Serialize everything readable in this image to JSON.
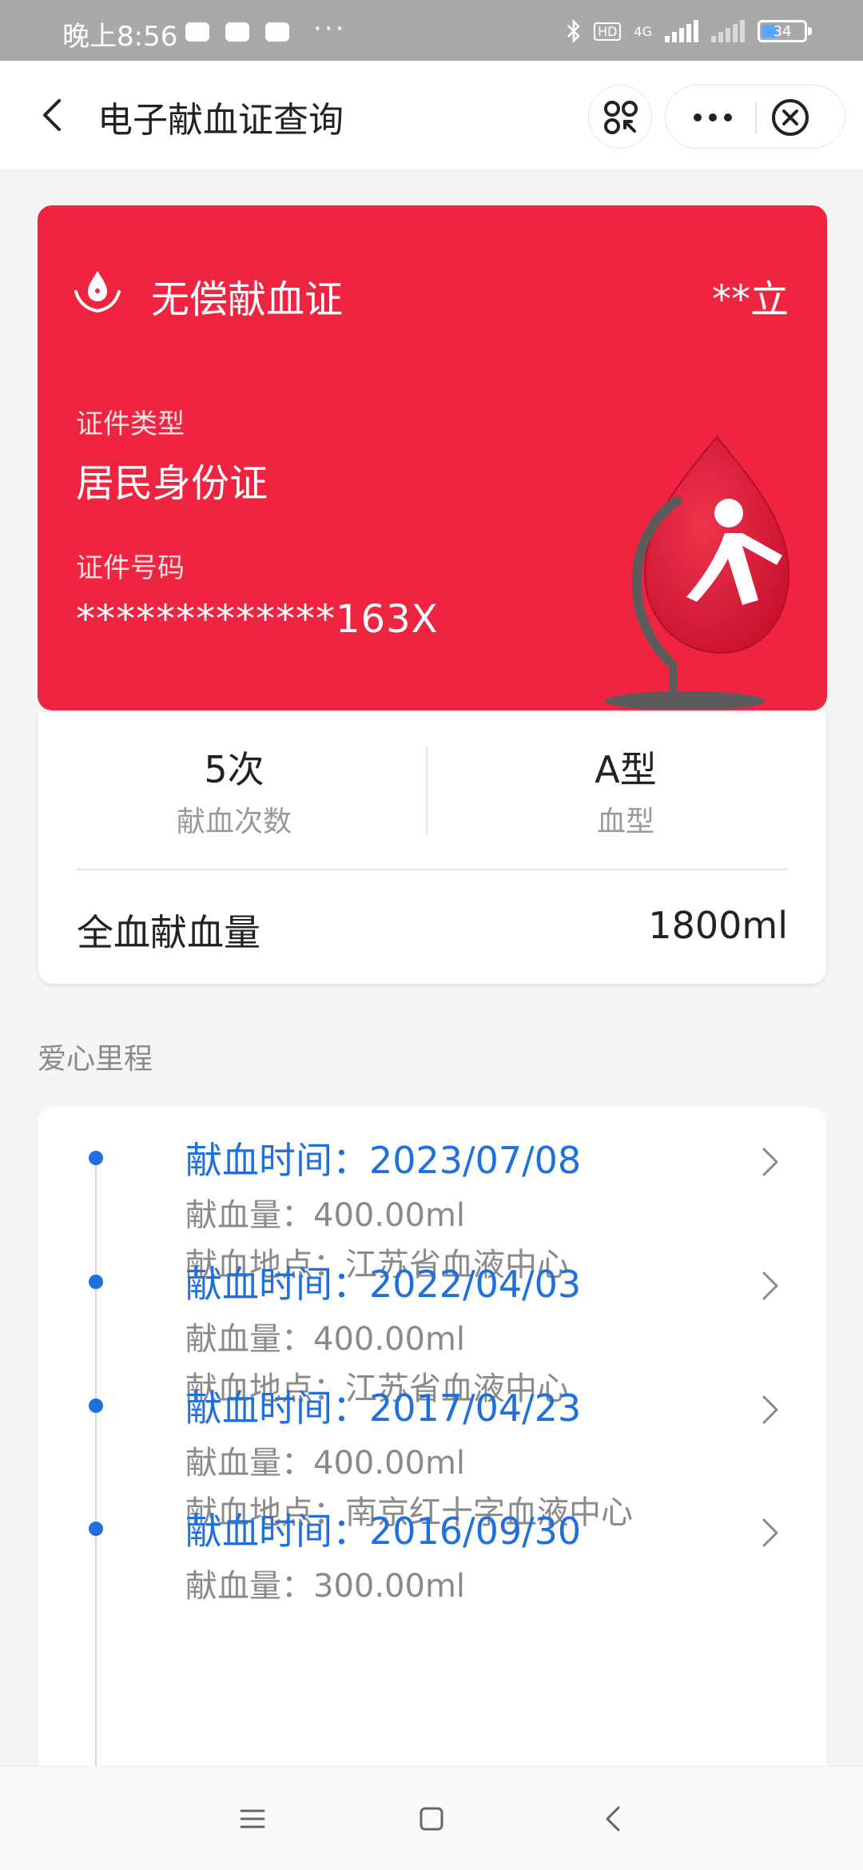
{
  "status_bar": {
    "time": "晚上8:56",
    "battery_percent": "34",
    "network": "4G",
    "hd": "HD",
    "icons": [
      "message-icon",
      "chat-icon",
      "app-icon",
      "more-notifications-icon",
      "bluetooth-icon",
      "signal-icon",
      "battery-icon"
    ]
  },
  "nav": {
    "title": "电子献血证查询",
    "icons": [
      "back-icon",
      "scan-icon",
      "more-icon",
      "close-icon"
    ]
  },
  "card": {
    "title": "无偿献血证",
    "holder_name": "**立",
    "id_type_label": "证件类型",
    "id_type_value": "居民身份证",
    "id_number_label": "证件号码",
    "id_number_value": "*************163X",
    "bg_color": "#ee2440"
  },
  "stats": {
    "donation_count_value": "5次",
    "donation_count_label": "献血次数",
    "blood_type_value": "A型",
    "blood_type_label": "血型",
    "whole_blood_label": "全血献血量",
    "whole_blood_value": "1800ml"
  },
  "section_title": "爱心里程",
  "records": [
    {
      "date": "献血时间：2023/07/08",
      "volume": "献血量：400.00ml",
      "place": "献血地点：江苏省血液中心"
    },
    {
      "date": "献血时间：2022/04/03",
      "volume": "献血量：400.00ml",
      "place": "献血地点：江苏省血液中心"
    },
    {
      "date": "献血时间：2017/04/23",
      "volume": "献血量：400.00ml",
      "place": "献血地点：南京红十字血液中心"
    },
    {
      "date": "献血时间：2016/09/30",
      "volume": "献血量：300.00ml",
      "place": ""
    }
  ],
  "accent_color": "#1f6fdc"
}
